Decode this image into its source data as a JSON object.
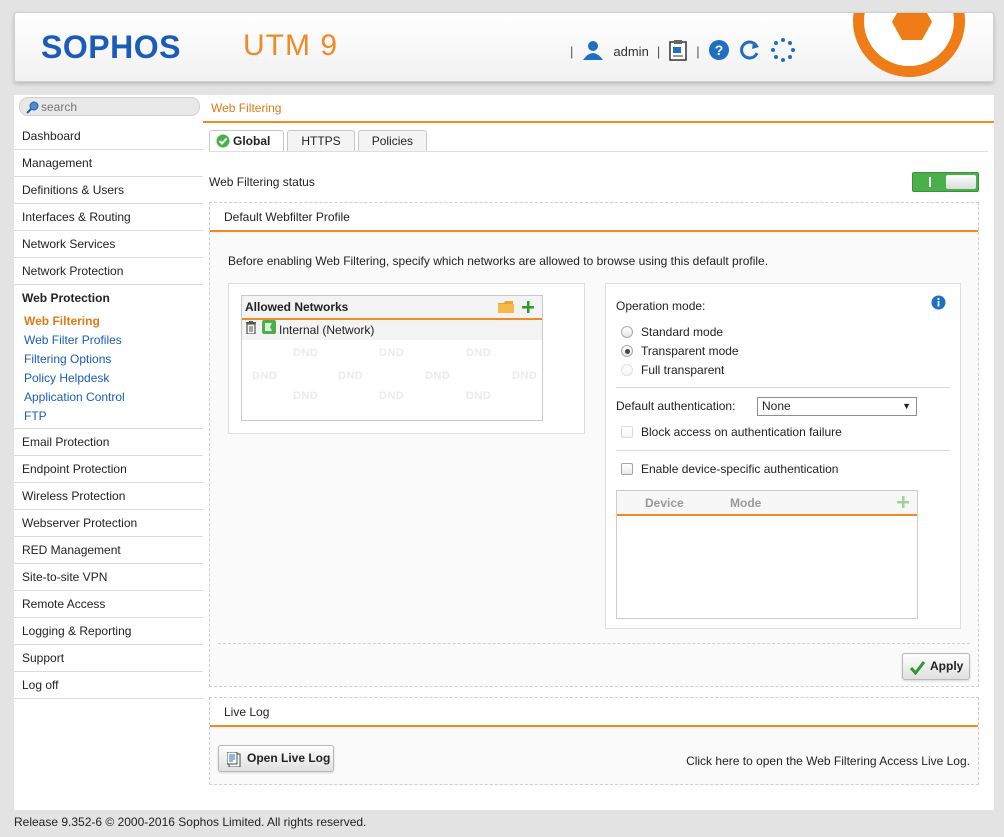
{
  "header": {
    "brand": "SOPHOS",
    "product": "UTM 9",
    "user": "admin",
    "separator": "|",
    "accent_color": "#f08a27",
    "brand_color": "#1a5cb8"
  },
  "search": {
    "placeholder": "search"
  },
  "nav": {
    "items_top": [
      "Dashboard",
      "Management",
      "Definitions & Users",
      "Interfaces & Routing",
      "Network Services",
      "Network Protection"
    ],
    "active_section": "Web Protection",
    "sub_items": [
      "Web Filtering",
      "Web Filter Profiles",
      "Filtering Options",
      "Policy Helpdesk",
      "Application Control",
      "FTP"
    ],
    "items_bottom": [
      "Email Protection",
      "Endpoint Protection",
      "Wireless Protection",
      "Webserver Protection",
      "RED Management",
      "Site-to-site VPN",
      "Remote Access",
      "Logging & Reporting",
      "Support",
      "Log off"
    ]
  },
  "main": {
    "breadcrumb": "Web Filtering",
    "tabs": [
      "Global",
      "HTTPS",
      "Policies"
    ],
    "status_label": "Web Filtering status",
    "profile_panel": {
      "title": "Default Webfilter Profile",
      "description": "Before enabling Web Filtering, specify which networks are allowed to browse using this default profile.",
      "allowed_networks": {
        "title": "Allowed Networks",
        "entries": [
          "Internal (Network)"
        ],
        "dnd_label": "DND"
      },
      "operation_mode_label": "Operation mode:",
      "modes": [
        "Standard mode",
        "Transparent mode",
        "Full transparent"
      ],
      "selected_mode": "Transparent mode",
      "default_auth_label": "Default authentication:",
      "default_auth_value": "None",
      "block_access_label": "Block access on authentication failure",
      "device_auth_label": "Enable device-specific authentication",
      "device_table_columns": [
        "Device",
        "Mode"
      ],
      "apply_label": "Apply"
    },
    "live_log_panel": {
      "title": "Live Log",
      "button_label": "Open Live Log",
      "hint": "Click here to open the Web Filtering Access Live Log."
    }
  },
  "footer": {
    "text": "Release 9.352-6  © 2000-2016 Sophos Limited. All rights reserved."
  }
}
